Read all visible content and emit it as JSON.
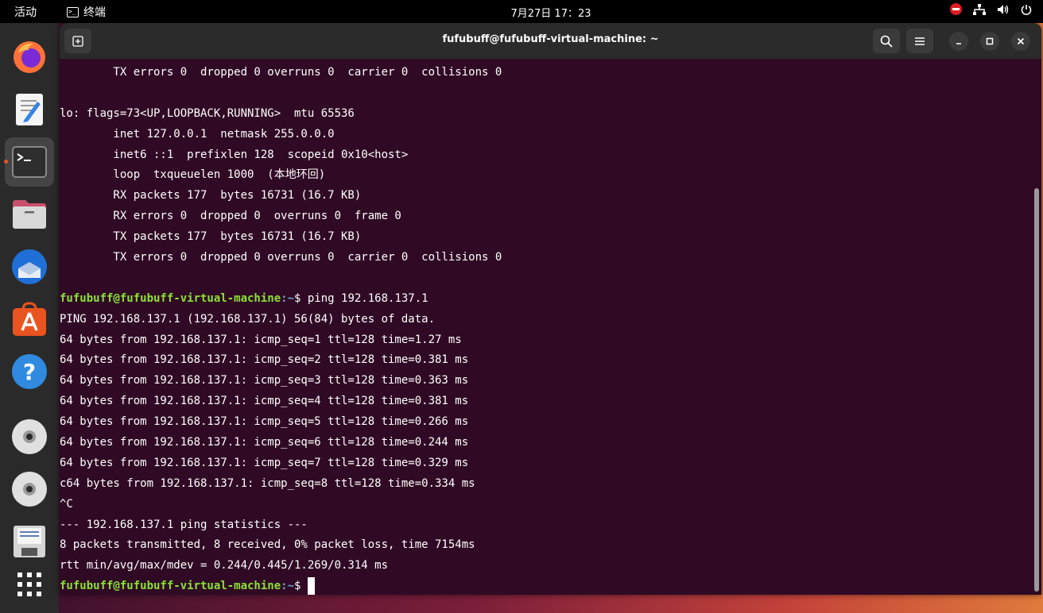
{
  "topbar": {
    "activities": "活动",
    "app_name": "终端",
    "clock": "7月27日  17：23"
  },
  "dock": {
    "items": [
      {
        "name": "firefox-icon"
      },
      {
        "name": "text-editor-icon"
      },
      {
        "name": "terminal-icon"
      },
      {
        "name": "files-icon"
      },
      {
        "name": "thunderbird-icon"
      },
      {
        "name": "app-center-icon"
      },
      {
        "name": "help-icon"
      },
      {
        "name": "disc-icon"
      },
      {
        "name": "disc-icon"
      },
      {
        "name": "floppy-icon"
      },
      {
        "name": "show-apps-icon"
      }
    ]
  },
  "window": {
    "title": "fufubuff@fufubuff-virtual-machine: ~"
  },
  "terminal": {
    "lines": [
      {
        "text": "        TX errors 0  dropped 0 overruns 0  carrier 0  collisions 0"
      },
      {
        "text": ""
      },
      {
        "text": "lo: flags=73<UP,LOOPBACK,RUNNING>  mtu 65536"
      },
      {
        "text": "        inet 127.0.0.1  netmask 255.0.0.0"
      },
      {
        "text": "        inet6 ::1  prefixlen 128  scopeid 0x10<host>"
      },
      {
        "text": "        loop  txqueuelen 1000  (本地环回)"
      },
      {
        "text": "        RX packets 177  bytes 16731 (16.7 KB)"
      },
      {
        "text": "        RX errors 0  dropped 0  overruns 0  frame 0"
      },
      {
        "text": "        TX packets 177  bytes 16731 (16.7 KB)"
      },
      {
        "text": "        TX errors 0  dropped 0 overruns 0  carrier 0  collisions 0"
      },
      {
        "text": ""
      },
      {
        "user": "fufubuff@fufubuff-virtual-machine",
        "path": ":~",
        "cmd": "$ ping 192.168.137.1"
      },
      {
        "text": "PING 192.168.137.1 (192.168.137.1) 56(84) bytes of data."
      },
      {
        "text": "64 bytes from 192.168.137.1: icmp_seq=1 ttl=128 time=1.27 ms"
      },
      {
        "text": "64 bytes from 192.168.137.1: icmp_seq=2 ttl=128 time=0.381 ms"
      },
      {
        "text": "64 bytes from 192.168.137.1: icmp_seq=3 ttl=128 time=0.363 ms"
      },
      {
        "text": "64 bytes from 192.168.137.1: icmp_seq=4 ttl=128 time=0.381 ms"
      },
      {
        "text": "64 bytes from 192.168.137.1: icmp_seq=5 ttl=128 time=0.266 ms"
      },
      {
        "text": "64 bytes from 192.168.137.1: icmp_seq=6 ttl=128 time=0.244 ms"
      },
      {
        "text": "64 bytes from 192.168.137.1: icmp_seq=7 ttl=128 time=0.329 ms"
      },
      {
        "text": "c64 bytes from 192.168.137.1: icmp_seq=8 ttl=128 time=0.334 ms"
      },
      {
        "text": "^C"
      },
      {
        "text": "--- 192.168.137.1 ping statistics ---"
      },
      {
        "text": "8 packets transmitted, 8 received, 0% packet loss, time 7154ms"
      },
      {
        "text": "rtt min/avg/max/mdev = 0.244/0.445/1.269/0.314 ms"
      },
      {
        "user": "fufubuff@fufubuff-virtual-machine",
        "path": ":~",
        "cmd": "$ ",
        "cursor": true
      }
    ]
  }
}
